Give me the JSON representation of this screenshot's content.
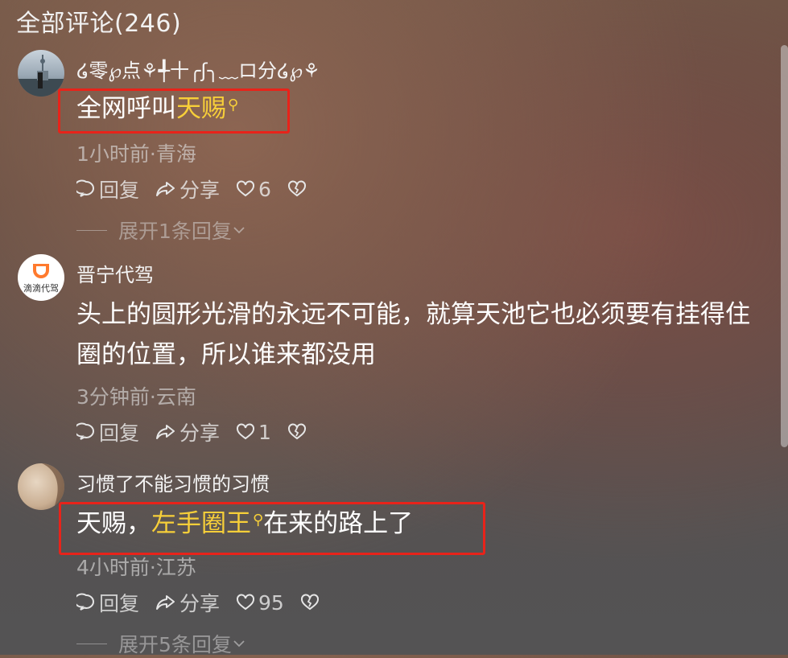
{
  "header": {
    "title": "全部评论(246)"
  },
  "comments": [
    {
      "username": "໒零℘点⚘╃十╭ʃ╮﹏ロ分໒℘⚘",
      "text_before": "全网呼叫",
      "highlight": "天赐",
      "text_after": "",
      "meta": "1小时前·青海",
      "reply_label": "回复",
      "share_label": "分享",
      "likes": "6",
      "expand": "展开1条回复"
    },
    {
      "username": "晋宁代驾",
      "avatar_text": "滴滴代驾",
      "text": "头上的圆形光滑的永远不可能，就算天池它也必须要有挂得住圈的位置，所以谁来都没用",
      "meta": "3分钟前·云南",
      "reply_label": "回复",
      "share_label": "分享",
      "likes": "1"
    },
    {
      "username": "习惯了不能习惯的习惯",
      "text_before": "天赐，",
      "highlight": "左手圈王",
      "text_after": "在来的路上了",
      "meta": "4小时前·江苏",
      "reply_label": "回复",
      "share_label": "分享",
      "likes": "95",
      "expand": "展开5条回复"
    }
  ],
  "colors": {
    "highlight": "#f7cf39",
    "annotation_box": "#e8231a"
  },
  "icons": [
    "reply-bubble-icon",
    "share-arrow-icon",
    "heart-icon",
    "dislike-broken-heart-icon",
    "chevron-down-icon",
    "search-icon"
  ]
}
